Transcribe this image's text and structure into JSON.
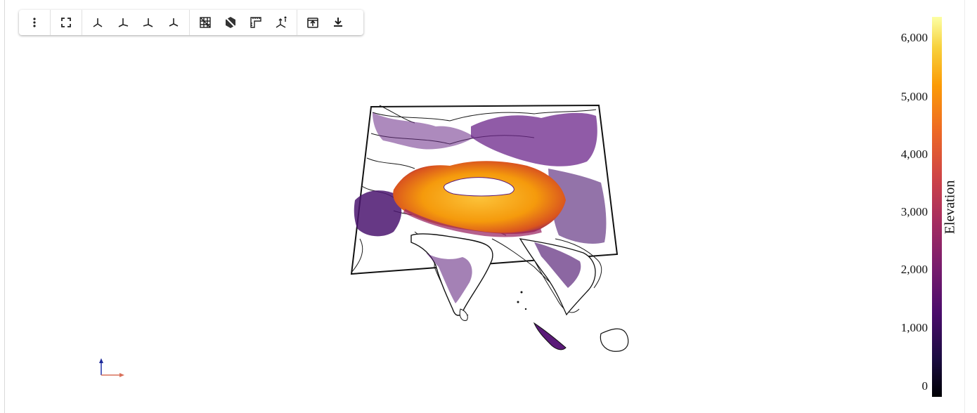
{
  "toolbar": {
    "buttons": [
      {
        "name": "more-options-button",
        "icon": "vertical-dots-icon"
      },
      {
        "name": "fullscreen-button",
        "icon": "expand-icon"
      },
      {
        "name": "view-xy-button",
        "icon": "axes-xy-icon"
      },
      {
        "name": "view-yz-button",
        "icon": "axes-yz-icon"
      },
      {
        "name": "view-xz-button",
        "icon": "axes-xz-icon"
      },
      {
        "name": "view-iso-button",
        "icon": "axes-iso-icon"
      },
      {
        "name": "toggle-grid-button",
        "icon": "grid-icon"
      },
      {
        "name": "toggle-bounds-button",
        "icon": "box-hidden-icon"
      },
      {
        "name": "ruler-button",
        "icon": "ruler-icon"
      },
      {
        "name": "axes-info-button",
        "icon": "axes-info-icon"
      },
      {
        "name": "open-external-button",
        "icon": "open-in-new-icon"
      },
      {
        "name": "download-button",
        "icon": "download-icon"
      }
    ]
  },
  "colorbar": {
    "title": "Elevation",
    "ticks": [
      "6,000",
      "5,000",
      "4,000",
      "3,000",
      "2,000",
      "1,000",
      "0"
    ],
    "colormap": "inferno",
    "range": [
      0,
      6300
    ]
  },
  "colors": {
    "outline": "#111111",
    "plateau": "#fb9b06",
    "highlands": "#5d1e7a"
  }
}
